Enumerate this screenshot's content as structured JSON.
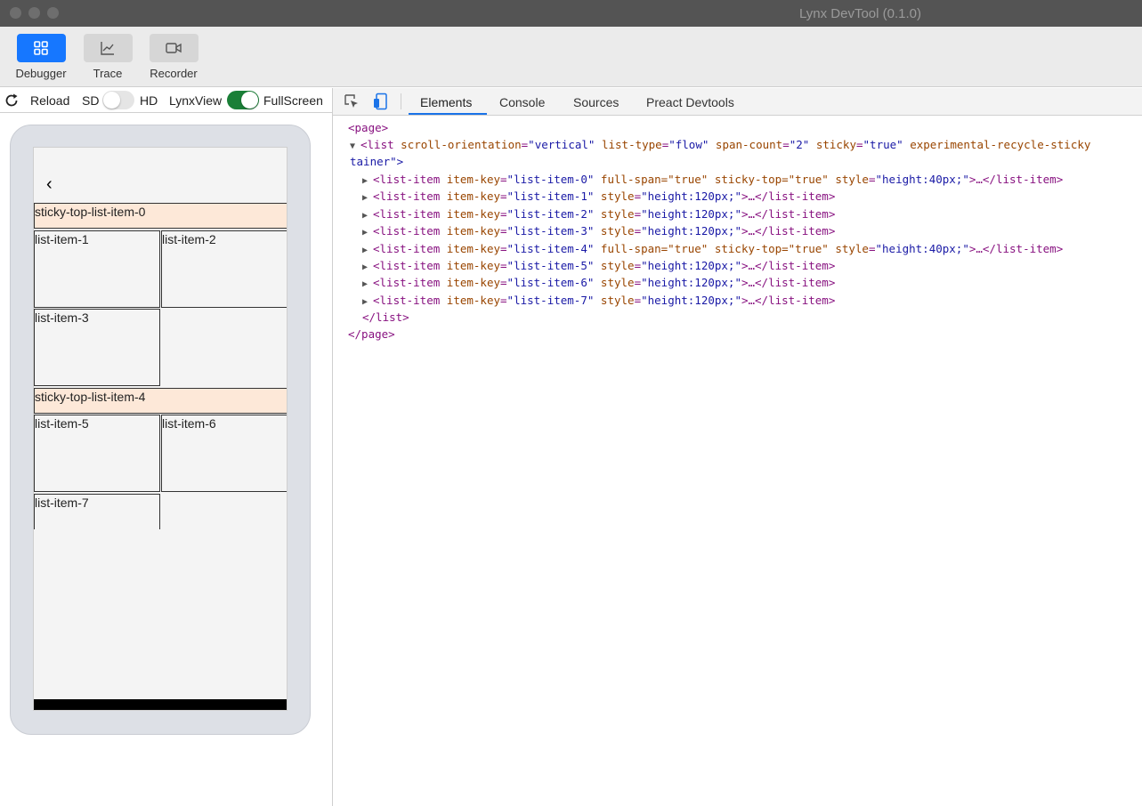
{
  "window": {
    "title": "Lynx DevTool (0.1.0)"
  },
  "toolbar": {
    "debugger_label": "Debugger",
    "trace_label": "Trace",
    "recorder_label": "Recorder"
  },
  "controls": {
    "reload_label": "Reload",
    "sd_label": "SD",
    "hd_label": "HD",
    "lynxview_label": "LynxView",
    "fullscreen_label": "FullScreen"
  },
  "tabs": {
    "elements": "Elements",
    "console": "Console",
    "sources": "Sources",
    "preact": "Preact Devtools"
  },
  "preview": {
    "items": [
      "sticky-top-list-item-0",
      "list-item-1",
      "list-item-2",
      "list-item-3",
      "sticky-top-list-item-4",
      "list-item-5",
      "list-item-6",
      "list-item-7"
    ]
  },
  "tree": {
    "page_open": "<page>",
    "list_tag": "<list",
    "list_attrs": [
      {
        "name": "scroll-orientation",
        "value": "\"vertical\""
      },
      {
        "name": "list-type",
        "value": "\"flow\""
      },
      {
        "name": "span-count",
        "value": "\"2\""
      },
      {
        "name": "sticky",
        "value": "\"true\""
      },
      {
        "name": "experimental-recycle-sticky",
        "value": ""
      }
    ],
    "list_wrap": "tainer\">",
    "children": [
      {
        "key": "\"list-item-0\"",
        "extra": "full-span=\"true\" sticky-top=\"true\" ",
        "style": "\"height:40px;\""
      },
      {
        "key": "\"list-item-1\"",
        "extra": "",
        "style": "\"height:120px;\""
      },
      {
        "key": "\"list-item-2\"",
        "extra": "",
        "style": "\"height:120px;\""
      },
      {
        "key": "\"list-item-3\"",
        "extra": "",
        "style": "\"height:120px;\""
      },
      {
        "key": "\"list-item-4\"",
        "extra": "full-span=\"true\" sticky-top=\"true\" ",
        "style": "\"height:40px;\""
      },
      {
        "key": "\"list-item-5\"",
        "extra": "",
        "style": "\"height:120px;\""
      },
      {
        "key": "\"list-item-6\"",
        "extra": "",
        "style": "\"height:120px;\""
      },
      {
        "key": "\"list-item-7\"",
        "extra": "",
        "style": "\"height:120px;\""
      }
    ],
    "list_close": "</list>",
    "page_close": "</page>"
  },
  "colors": {
    "accent": "#1677ff",
    "toggle_on": "#1a7f37",
    "sticky_bg": "#fde8d8"
  }
}
